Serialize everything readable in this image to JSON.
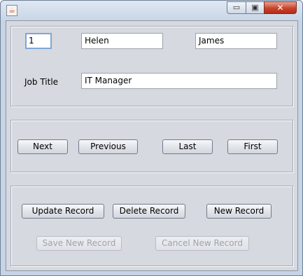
{
  "window": {
    "icon": "java-cup-icon",
    "controls": {
      "minimize": "▭",
      "maximize": "▣",
      "close": "✕"
    }
  },
  "record": {
    "id": "1",
    "first_name": "Helen",
    "last_name": "James",
    "job_title_label": "Job Title",
    "job_title": "IT Manager"
  },
  "navigation": {
    "next": "Next",
    "previous": "Previous",
    "last": "Last",
    "first": "First"
  },
  "actions": {
    "update": "Update Record",
    "delete": "Delete Record",
    "new": "New Record",
    "save_new": "Save New Record",
    "cancel_new": "Cancel New Record"
  }
}
